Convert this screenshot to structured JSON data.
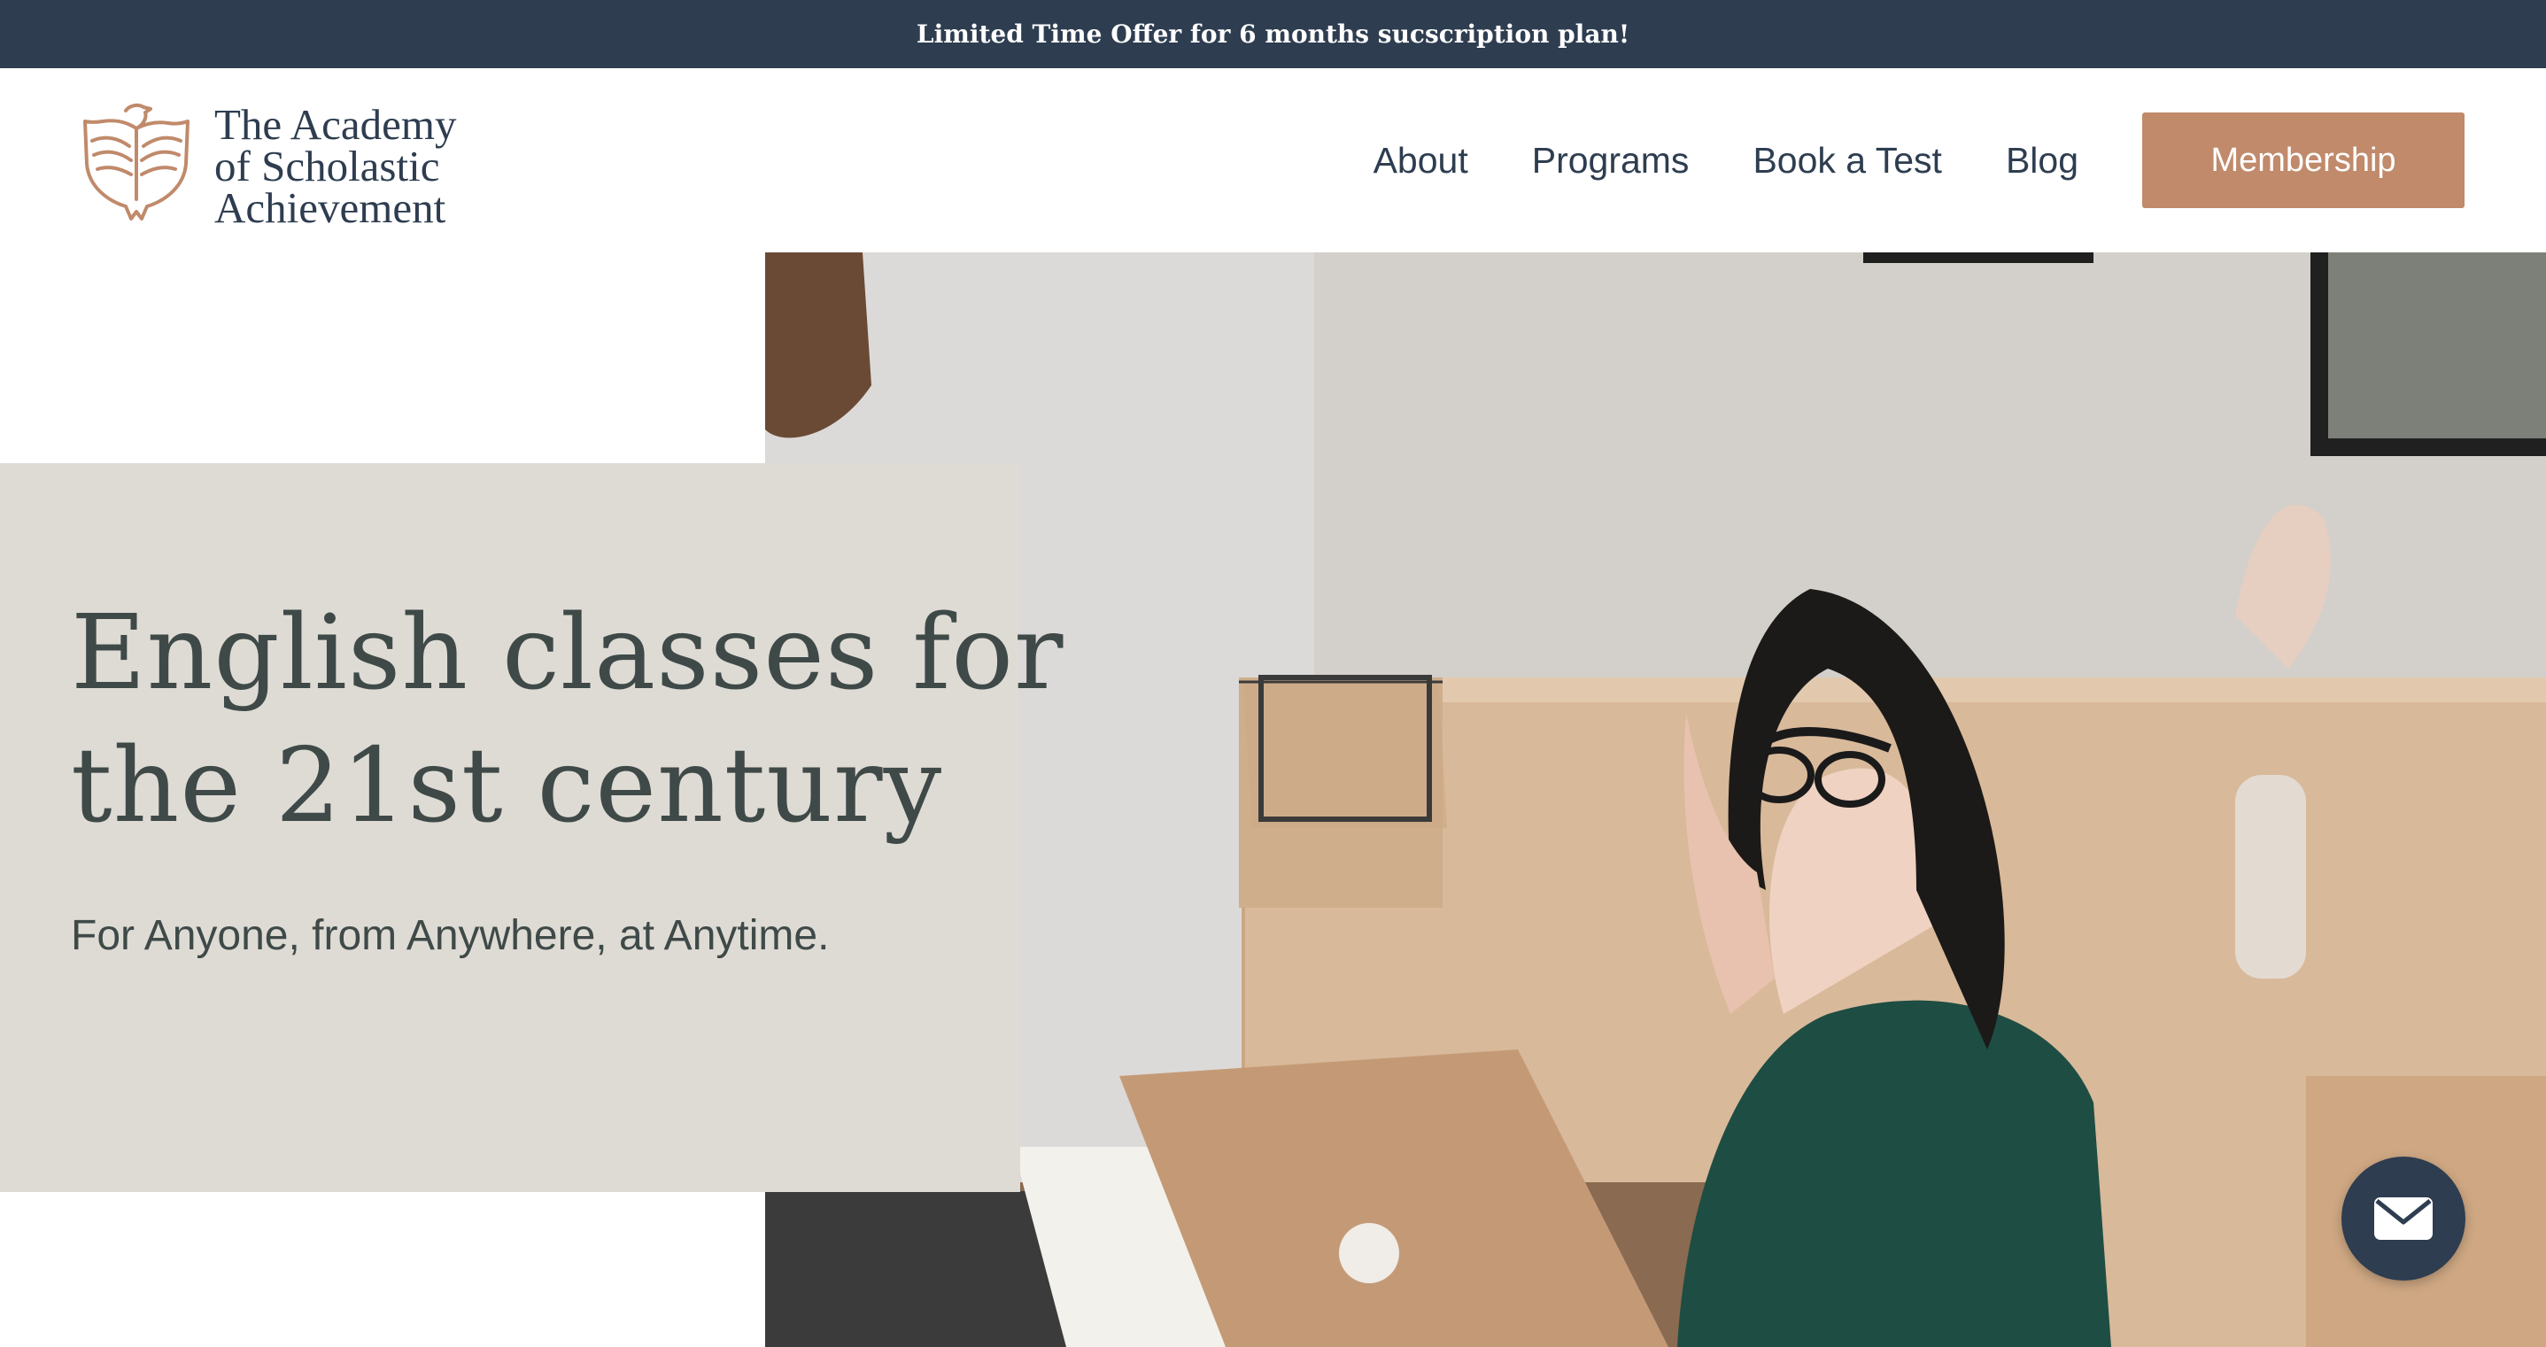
{
  "promo": {
    "text": "Limited Time Offer for 6 months sucscription plan!"
  },
  "brand": {
    "name_lines": [
      "The Academy",
      "of Scholastic",
      "Achievement"
    ],
    "logo_icon": "eagle-shield-logo-icon"
  },
  "nav": {
    "items": [
      {
        "label": "About"
      },
      {
        "label": "Programs"
      },
      {
        "label": "Book a Test"
      },
      {
        "label": "Blog"
      }
    ],
    "cta_label": "Membership"
  },
  "hero": {
    "title_lines": [
      "English classes for",
      "the 21st century"
    ],
    "subtitle": "For Anyone, from Anywhere, at Anytime."
  },
  "contact_fab": {
    "icon": "envelope-icon"
  },
  "colors": {
    "navy": "#2e3d50",
    "accent": "#c08a6b",
    "hero_card_bg": "#dedbd5",
    "hero_text": "#3f4a48"
  }
}
